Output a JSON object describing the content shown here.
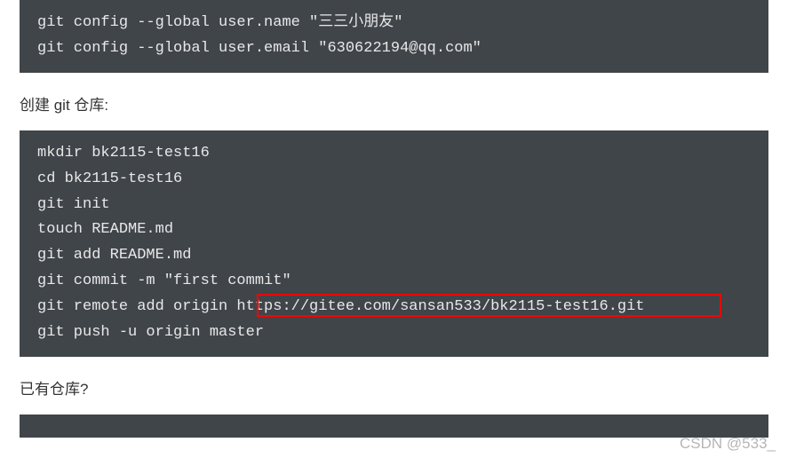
{
  "block1": {
    "lines": [
      "git config --global user.name \"三三小朋友\"",
      "git config --global user.email \"630622194@qq.com\""
    ]
  },
  "heading1": "创建 git 仓库:",
  "block2": {
    "lines": [
      "mkdir bk2115-test16",
      "cd bk2115-test16",
      "git init",
      "touch README.md",
      "git add README.md",
      "git commit -m \"first commit\"",
      "git remote add origin https://gitee.com/sansan533/bk2115-test16.git",
      "git push -u origin master"
    ],
    "highlighted_url": "https://gitee.com/sansan533/bk2115-test16.git"
  },
  "heading2": "已有仓库?",
  "watermark": "CSDN @533_"
}
